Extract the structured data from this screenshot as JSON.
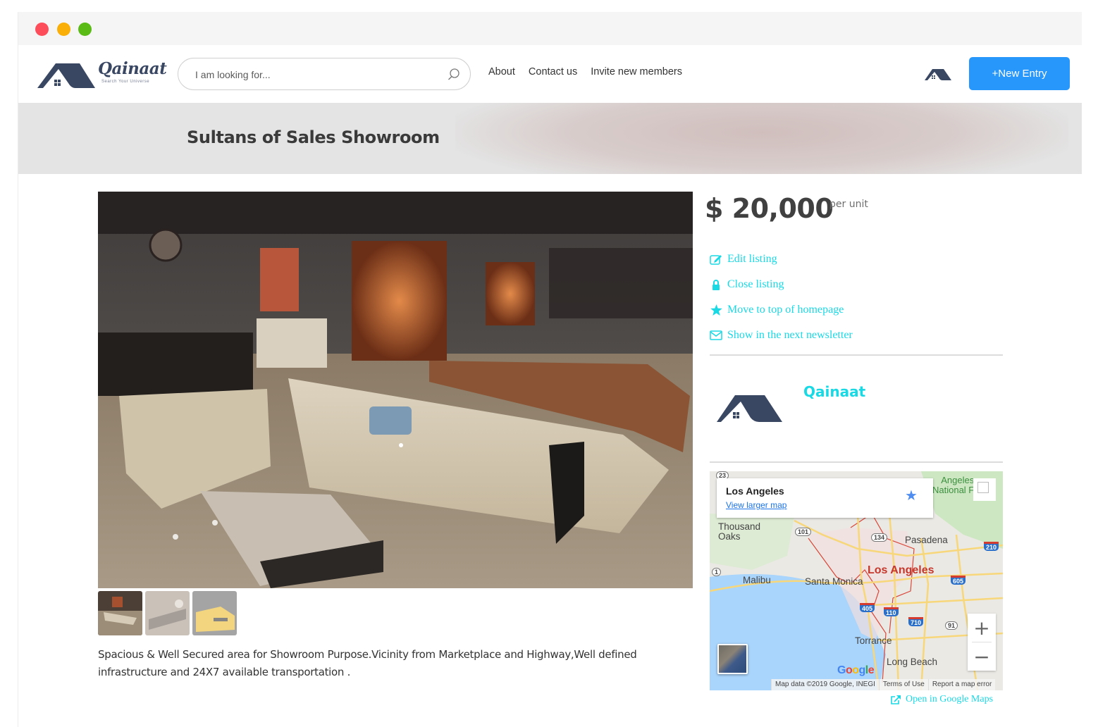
{
  "window": {
    "controls": [
      "close",
      "minimize",
      "maximize"
    ]
  },
  "navbar": {
    "logo": {
      "wordmark": "Qainaat",
      "tagline": "Search Your Universe"
    },
    "search": {
      "placeholder": "I am looking for...",
      "value": ""
    },
    "links": [
      {
        "label": "About"
      },
      {
        "label": "Contact us"
      },
      {
        "label": "Invite new members"
      }
    ],
    "new_entry_label": "+New Entry",
    "accent_color": "#2897fb"
  },
  "banner": {
    "title": "Sultans of Sales Showroom"
  },
  "listing": {
    "price": "$ 20,000",
    "price_unit": "per unit",
    "actions": [
      {
        "label": "Edit listing",
        "icon": "edit-icon"
      },
      {
        "label": "Close listing",
        "icon": "lock-icon"
      },
      {
        "label": "Move to top of homepage",
        "icon": "star-icon"
      },
      {
        "label": "Show in the next newsletter",
        "icon": "envelope-icon"
      }
    ],
    "action_color": "#19d9e5",
    "description": "Spacious & Well Secured area for Showroom Purpose.Vicinity from Marketplace and Highway,Well defined infrastructure and 24X7 available transportation .",
    "thumbnails": [
      {
        "name": "showroom-sofa",
        "selected": true
      },
      {
        "name": "interior-decor",
        "selected": false
      },
      {
        "name": "yellow-car",
        "selected": false
      }
    ]
  },
  "owner": {
    "name": "Qainaat"
  },
  "map": {
    "place_title": "Los Angeles",
    "view_larger": "View larger map",
    "labels": {
      "thousand_oaks": "Thousand\nOaks",
      "malibu": "Malibu",
      "santa_monica": "Santa Monica",
      "los_angeles": "Los Angeles",
      "pasadena": "Pasadena",
      "torrance": "Torrance",
      "long_beach": "Long Beach",
      "angeles_nf": "Angeles\nNational F"
    },
    "shields": {
      "r23": "23",
      "r101": "101",
      "r134": "134",
      "r1": "1",
      "i210": "210",
      "i605": "605",
      "i405": "405",
      "i110": "110",
      "i710": "710",
      "r91": "91"
    },
    "zoom_in": "+",
    "zoom_out": "−",
    "google": "Google",
    "footer": {
      "data": "Map data ©2019 Google, INEGI",
      "terms": "Terms of Use",
      "report": "Report a map error"
    },
    "open_link": "Open in Google Maps"
  }
}
